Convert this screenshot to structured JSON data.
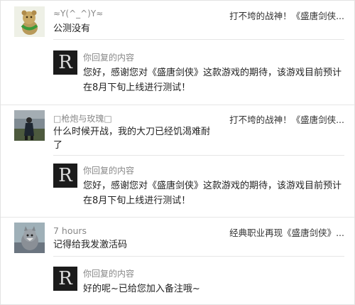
{
  "comments": [
    {
      "user": "≈Y(^_^)Y≈",
      "topic": "打不垮的战神！《盛唐剑侠...",
      "text": "公测没有",
      "reply_label": "你回复的内容",
      "reply_text": "您好，感谢您对《盛唐剑侠》这款游戏的期待，该游戏目前预计在8月下旬上线进行测试！"
    },
    {
      "user": "□枪炮与玫瑰□",
      "topic": "打不垮的战神！《盛唐剑侠...",
      "text": "什么时候开战，我的大刀已经饥渴难耐了",
      "reply_label": "你回复的内容",
      "reply_text": "您好，感谢您对《盛唐剑侠》这款游戏的期待，该游戏目前预计在8月下旬上线进行测试！"
    },
    {
      "user": "7 hours",
      "topic": "经典职业再现《盛唐剑侠》...",
      "text": "记得给我发激活码",
      "reply_label": "你回复的内容",
      "reply_text": "好的呢~已给您加入备注哦~"
    }
  ],
  "reply_avatar_letter": "R",
  "colors": {
    "divider": "#e6e6e6",
    "muted_text": "#888888",
    "reply_avatar_bg": "#1b1b1b"
  }
}
